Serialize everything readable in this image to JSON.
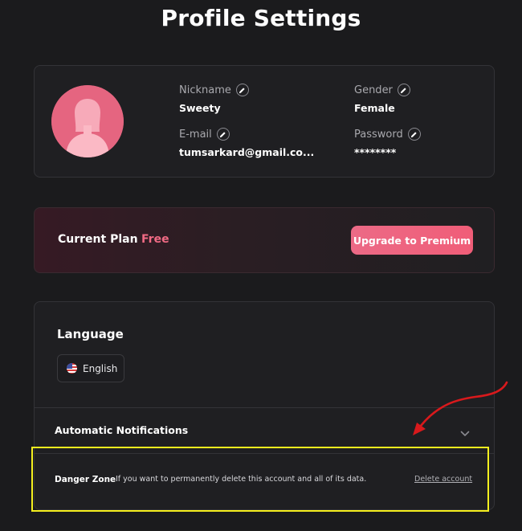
{
  "page": {
    "title": "Profile Settings"
  },
  "profile": {
    "avatar_icon": "user-avatar-icon",
    "fields": {
      "nickname": {
        "label": "Nickname",
        "value": "Sweety"
      },
      "gender": {
        "label": "Gender",
        "value": "Female"
      },
      "email": {
        "label": "E-mail",
        "value": "tumsarkard@gmail.co..."
      },
      "password": {
        "label": "Password",
        "value": "********"
      }
    },
    "edit_icon": "pencil-icon"
  },
  "plan": {
    "label": "Current Plan",
    "value": "Free",
    "upgrade_label": "Upgrade to Premium"
  },
  "settings": {
    "language": {
      "label": "Language",
      "selected": "English",
      "flag_icon": "us-flag-icon"
    },
    "notifications": {
      "label": "Automatic Notifications",
      "chevron_icon": "chevron-down-icon"
    },
    "danger_zone": {
      "label": "Danger Zone",
      "text": "If you want to permanently delete this account and all of its data.",
      "delete_label": "Delete account"
    }
  },
  "annotations": {
    "highlight_color": "#f5ef1e",
    "arrow_color": "#d8191c"
  },
  "colors": {
    "background": "#1b1b1d",
    "accent": "#f06a84",
    "card": "#1f1f22"
  }
}
